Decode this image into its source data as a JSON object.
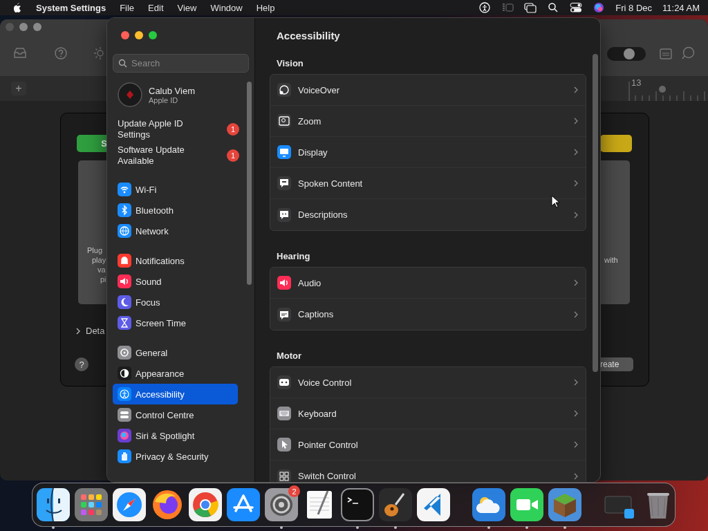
{
  "menu_bar": {
    "app_name": "System Settings",
    "menus": [
      "File",
      "Edit",
      "View",
      "Window",
      "Help"
    ],
    "date": "Fri 8 Dec",
    "time": "11:24 AM"
  },
  "background_window": {
    "toggle": {
      "on": true
    },
    "add_button": "+",
    "ruler_number": "13",
    "left_button": "S",
    "left_text": [
      "Plug",
      "play",
      "va",
      "pi"
    ],
    "right_text": "with",
    "disclosure": "Deta",
    "help_button": "?",
    "right_button": "reate"
  },
  "settings": {
    "search": {
      "placeholder": "Search"
    },
    "account": {
      "name": "Calub Viem",
      "subtitle": "Apple ID"
    },
    "alerts": [
      {
        "label": "Update Apple ID Settings",
        "badge": "1"
      },
      {
        "label": "Software Update Available",
        "badge": "1"
      }
    ],
    "sidebar_groups": [
      {
        "items": [
          {
            "label": "Wi-Fi",
            "selected": false
          },
          {
            "label": "Bluetooth",
            "selected": false
          },
          {
            "label": "Network",
            "selected": false
          }
        ]
      },
      {
        "items": [
          {
            "label": "Notifications",
            "selected": false
          },
          {
            "label": "Sound",
            "selected": false
          },
          {
            "label": "Focus",
            "selected": false
          },
          {
            "label": "Screen Time",
            "selected": false
          }
        ]
      },
      {
        "items": [
          {
            "label": "General",
            "selected": false
          },
          {
            "label": "Appearance",
            "selected": false
          },
          {
            "label": "Accessibility",
            "selected": true
          },
          {
            "label": "Control Centre",
            "selected": false
          },
          {
            "label": "Siri & Spotlight",
            "selected": false
          },
          {
            "label": "Privacy & Security",
            "selected": false
          }
        ]
      }
    ],
    "title": "Accessibility",
    "sections": [
      {
        "title": "Vision",
        "items": [
          "VoiceOver",
          "Zoom",
          "Display",
          "Spoken Content",
          "Descriptions"
        ]
      },
      {
        "title": "Hearing",
        "items": [
          "Audio",
          "Captions"
        ]
      },
      {
        "title": "Motor",
        "items": [
          "Voice Control",
          "Keyboard",
          "Pointer Control",
          "Switch Control"
        ]
      }
    ]
  },
  "dock": {
    "apps": [
      {
        "running": true
      },
      {
        "running": false
      },
      {
        "running": false
      },
      {
        "running": false
      },
      {
        "running": false
      },
      {
        "running": false
      },
      {
        "running": true,
        "badge": "2"
      },
      {
        "running": false
      },
      {
        "running": true
      },
      {
        "running": true
      },
      {
        "running": false
      },
      {
        "running": true
      },
      {
        "running": true
      },
      {
        "running": true
      },
      {
        "running": false
      },
      {
        "running": false
      }
    ]
  }
}
